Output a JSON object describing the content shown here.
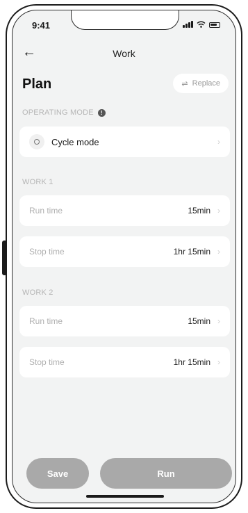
{
  "status": {
    "time": "9:41"
  },
  "nav": {
    "title": "Work",
    "back_icon": "arrow-left-icon"
  },
  "plan": {
    "title": "Plan",
    "replace_label": "Replace",
    "replace_icon": "swap-arrows-icon"
  },
  "operating_mode": {
    "label": "OPERATING MODE",
    "value": "Cycle mode"
  },
  "work_groups": [
    {
      "label": "WORK 1",
      "rows": [
        {
          "label": "Run time",
          "value": "15min"
        },
        {
          "label": "Stop time",
          "value": "1hr 15min"
        }
      ]
    },
    {
      "label": "WORK 2",
      "rows": [
        {
          "label": "Run time",
          "value": "15min"
        },
        {
          "label": "Stop time",
          "value": "1hr 15min"
        }
      ]
    }
  ],
  "actions": {
    "save_label": "Save",
    "run_label": "Run"
  },
  "colors": {
    "button_gray": "#a9a9a9",
    "screen_bg": "#f2f3f3",
    "card_bg": "#ffffff"
  }
}
